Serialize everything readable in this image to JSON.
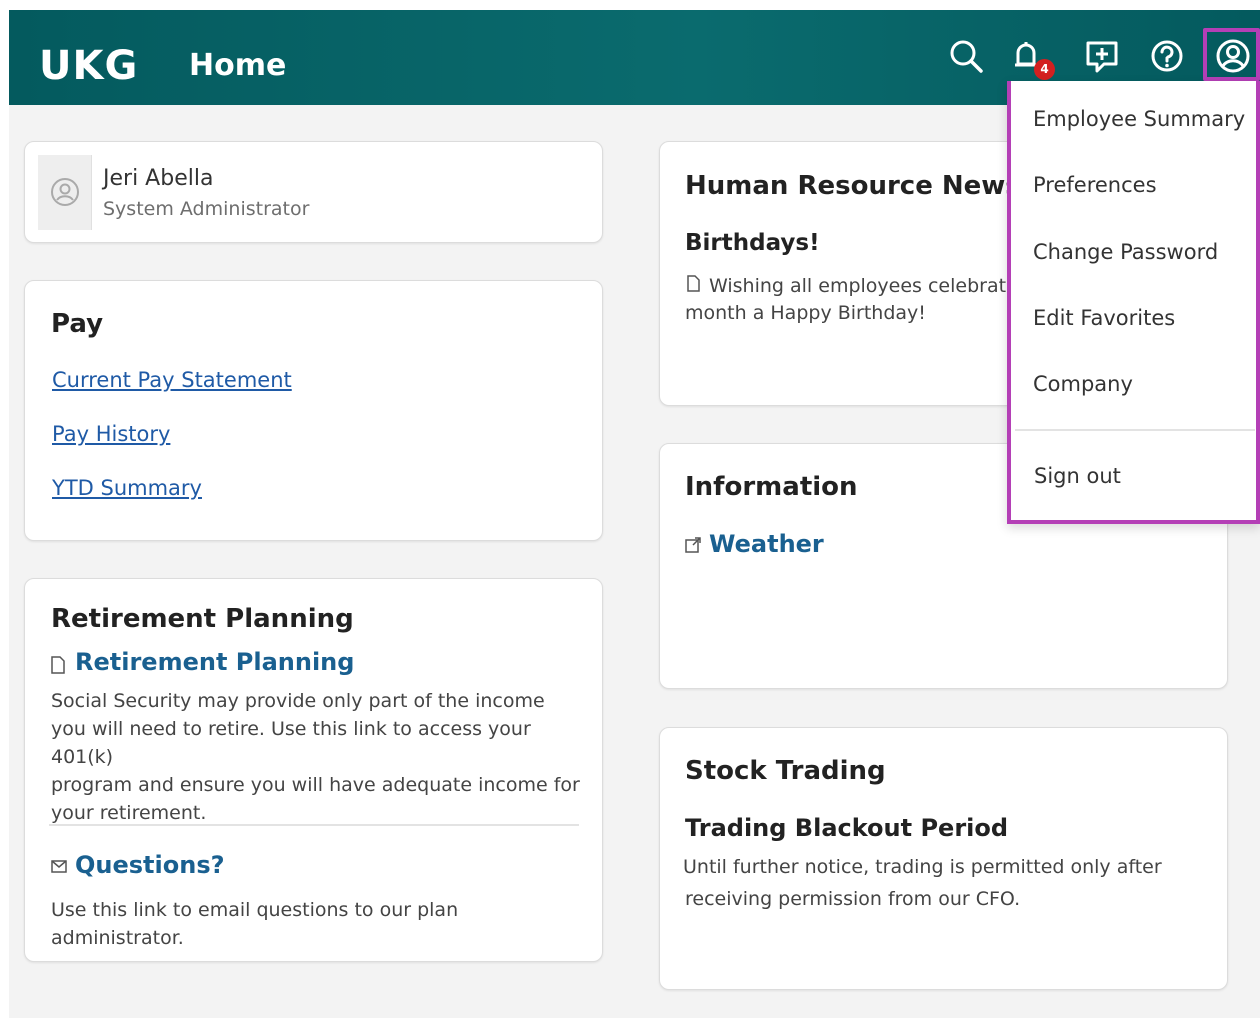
{
  "header": {
    "logo": "UKG",
    "title": "Home",
    "notification_count": "4",
    "icons": [
      "search-icon",
      "bell-icon",
      "feedback-icon",
      "help-icon",
      "profile-icon"
    ],
    "brand_color": "#045a5e"
  },
  "profile_card": {
    "name": "Jeri Abella",
    "role": "System Administrator"
  },
  "pay": {
    "title": "Pay",
    "links": [
      "Current Pay Statement",
      "Pay History",
      "YTD Summary"
    ]
  },
  "retirement": {
    "title": "Retirement Planning",
    "link": "Retirement Planning",
    "desc_lines": [
      "Social Security may provide only part of the income",
      "you will need to retire. Use this link to access your 401(k)",
      "program and ensure you will have adequate income for",
      "your retirement."
    ],
    "questions_link": "Questions?",
    "questions_lines": [
      "Use this link to email questions to our plan",
      "administrator."
    ]
  },
  "hr_news": {
    "title": "Human Resource News",
    "subtitle": "Birthdays!",
    "text_line1": "Wishing all employees celebratin",
    "text_line2": "month a Happy Birthday!"
  },
  "information": {
    "title": "Information",
    "link": "Weather"
  },
  "stock": {
    "title": "Stock Trading",
    "subtitle": "Trading Blackout Period",
    "text_line1": "Until further notice, trading is permitted only after",
    "text_line2": "receiving permission from our CFO."
  },
  "profile_menu": {
    "items": [
      "Employee Summary",
      "Preferences",
      "Change Password",
      "Edit Favorites",
      "Company"
    ],
    "sign_out": "Sign out",
    "highlight_color": "#b43fb6"
  }
}
